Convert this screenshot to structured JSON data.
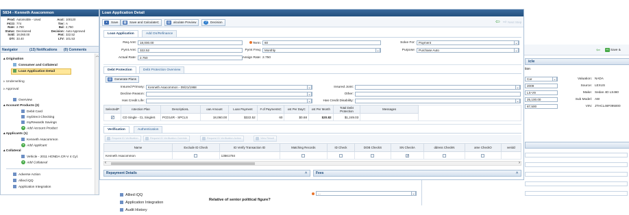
{
  "header": {
    "title": "5834 - Kenneth Asacommon"
  },
  "summary": [
    {
      "k": "Prod:",
      "v": "Automobile - Used"
    },
    {
      "k": "Acct:",
      "v": "100120"
    },
    {
      "k": "FICO:",
      "v": "774"
    },
    {
      "k": "Tier:",
      "v": "A"
    },
    {
      "k": "Rate:",
      "v": "2.750"
    },
    {
      "k": "Bal:",
      "v": "2,750"
    },
    {
      "k": "Status:",
      "v": "Decisioned"
    },
    {
      "k": "Decision:",
      "v": "Auto Approved"
    },
    {
      "k": "Sold:",
      "v": "18,060.00"
    },
    {
      "k": "Pmt:",
      "v": "322.52"
    },
    {
      "k": "DTI:",
      "v": "33.40"
    },
    {
      "k": "LTV:",
      "v": "101.53"
    }
  ],
  "nav_tabs": [
    {
      "label": "Navigator"
    },
    {
      "label": "(13) Notifications"
    },
    {
      "label": "(0) Comments"
    }
  ],
  "origination": {
    "group": "Origination",
    "items": [
      "Consumer and Collateral",
      "Loan Application Detail"
    ]
  },
  "nav_misc": [
    "Underwriting",
    "Approval",
    "Overview"
  ],
  "account_products": {
    "group": "Account Products (3)",
    "items": [
      "Debit Card",
      "myDirect Checking",
      "myRewards Savings"
    ],
    "add": "Add Account Product"
  },
  "applicants": {
    "group": "Applicants (1)",
    "items": [
      "Kenneth Asacommon"
    ],
    "add": "Add Applicant"
  },
  "collateral": {
    "group": "Collateral",
    "items": [
      "Vehicle - 2011 HONDA CR-V 4 Cyl."
    ],
    "add": "Add Collateral"
  },
  "nav_bottom": [
    "Adverse Action",
    "Allied iQQ",
    "Application Integration"
  ],
  "nav_overflow": [
    "Allied iQQ",
    "Application Integration",
    "Audit History"
  ],
  "main": {
    "title": "Loan Application Detail"
  },
  "toolbar": {
    "save": "Save",
    "save_calc": "Save and CalculateC",
    "calc_preview": "alculate Preview",
    "decision": "Decision",
    "next": "Next Step"
  },
  "loan_tabs": [
    "Loan Application",
    "Add On/Refinance"
  ],
  "loan": {
    "req_amt_label": "Req Amt:",
    "req_amt": "18,000.00",
    "pymt_amt_label": "Pymt Amt:",
    "pymt_amt": "322.52",
    "actual_rate_label": "Actual Rate:",
    "actual_rate": "2.750",
    "term_label": "Term:",
    "term": "60",
    "pymt_freq_label": "Pymt Freq:",
    "pymt_freq": "Monthly",
    "assign_rate_label": "Assign Rate:",
    "assign_rate": "2.750",
    "solve_for_label": "Solve For:",
    "solve_for": "Payment",
    "purpose_label": "Purpose:",
    "purpose": "Purchase Auto"
  },
  "debt_tabs": [
    "Debt Protection",
    "Debt Protection Overview"
  ],
  "debt": {
    "generate_plans": "Generate Plans",
    "insured_primary_label": "Insured Primary:",
    "insured_primary": "Kenneth Asacommon - 09/21/1968",
    "decline_reason_label": "Decline Reason:",
    "has_credit_life_label": "Has Credit Life:",
    "insured_joint_label": "Insured Joint:",
    "other_label": "Other:",
    "has_credit_disability_label": "Has Credit Disability:",
    "columns": [
      "SelectedP",
      "rotection Plan",
      "DescriptionL",
      "oan Amount",
      "Loan Payment",
      "# of PaymentsC",
      "ost Per DayC",
      "ost Per Month",
      "Total Debt Protection",
      "Messages"
    ],
    "row": [
      "",
      "CD Single - CL SingleS",
      "PCD14R - SPCLS",
      "18,060.00",
      "$322.52",
      "60",
      "$0.68",
      "$20.82",
      "$1,249.03",
      ""
    ]
  },
  "verif_tabs": [
    "Verification",
    "Authentication"
  ],
  "verif": {
    "toolbar": [
      "Request ID Verification",
      "Request ID Verification Override",
      "Request ID Verification Action",
      "View Result"
    ],
    "columns": [
      "Name",
      "Exclude ID Check",
      "ID Verify Transaction ID",
      "Matching Records",
      "ID Check",
      "DOB CheckS",
      "SN CheckA",
      "ddress CheckN",
      "ame CheckO",
      "veridd"
    ],
    "row": {
      "name": "Kenneth Asacommon",
      "txn": "13561784"
    }
  },
  "repayment": {
    "title": "Repayment Details"
  },
  "fees": {
    "title": "Fees"
  },
  "question": "Relative of senior political figure?",
  "question_value": "...",
  "right_panel": {
    "save": "Save &",
    "title": "icle",
    "tab": "tion",
    "left_values": [
      "Car",
      "2009",
      "LS-V9",
      "25,100.00",
      "87,500"
    ],
    "right_labels": [
      "Valuation:",
      "Source:",
      "Make:",
      "Sub Model:",
      "VIN:"
    ],
    "right_values": [
      "NADA",
      "LEXUS",
      "Sedan 4D LS460",
      "AW",
      "JTHCL46F095000"
    ]
  },
  "colors": {
    "title_bar": "#2d5d8f",
    "accent": "#1d4a7a",
    "header_bg": "#dbe6f2",
    "ok_green": "#3fa23f",
    "req_orange": "#e8742c"
  }
}
